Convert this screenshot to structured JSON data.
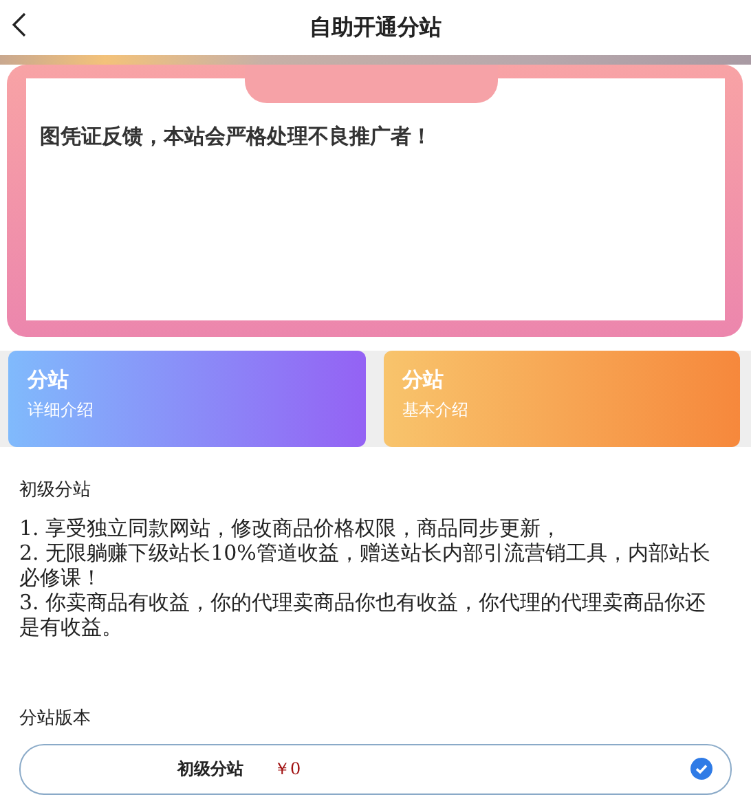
{
  "header": {
    "title": "自助开通分站"
  },
  "notice": {
    "text": "图凭证反馈，本站会严格处理不良推广者！"
  },
  "cards": [
    {
      "title": "分站",
      "subtitle": "详细介绍",
      "kind": "purple"
    },
    {
      "title": "分站",
      "subtitle": "基本介绍",
      "kind": "orange"
    }
  ],
  "description": {
    "heading": "初级分站",
    "lines": [
      "1. 享受独立同款网站，修改商品价格权限，商品同步更新，",
      "2. 无限躺赚下级站长10%管道收益，赠送站长内部引流营销工具，内部站长必修课！",
      "3. 你卖商品有收益，你的代理卖商品你也有收益，你代理的代理卖商品你还是有收益。"
    ]
  },
  "versions": {
    "heading": "分站版本",
    "options": [
      {
        "name": "初级分站",
        "price": "￥0",
        "selected": true
      }
    ]
  }
}
